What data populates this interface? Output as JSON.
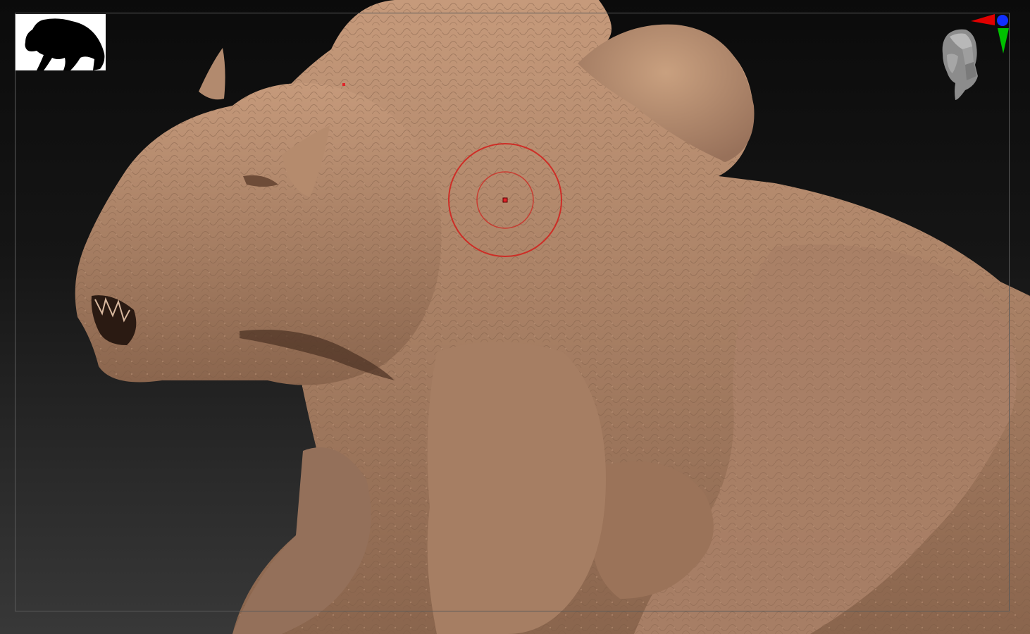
{
  "viewport": {
    "background_top": "#0b0b0b",
    "background_bottom": "#383838",
    "frame_color": "#5a5a5a"
  },
  "model": {
    "material_color": "#a57d62",
    "highlight_color": "#c69a7b",
    "shadow_color": "#6a4a37"
  },
  "silhouette_thumbnail": {
    "background": "#ffffff",
    "fill": "#000000"
  },
  "navigation_widget": {
    "head_icon": "gray-head-icon",
    "x_axis_color": "#e00000",
    "y_axis_color": "#00c000",
    "z_axis_color": "#1030ff"
  },
  "brush_cursor": {
    "ring_color": "#d0231f",
    "center_color": "#e0242a"
  }
}
